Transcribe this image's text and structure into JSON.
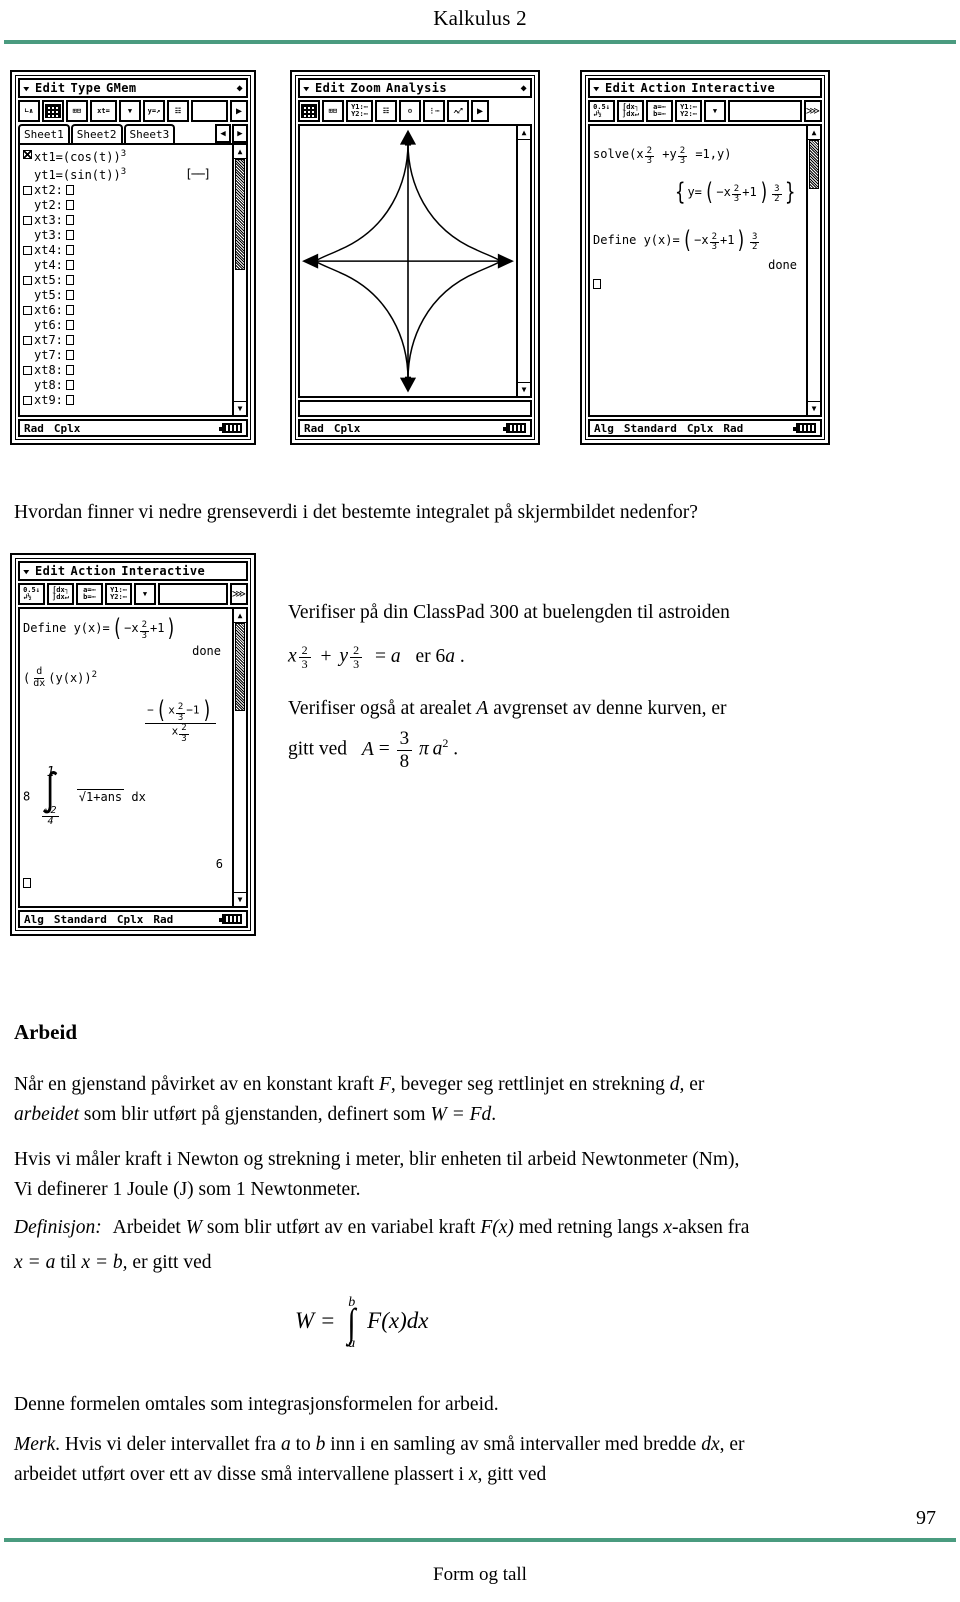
{
  "header": {
    "title": "Kalkulus 2",
    "rule_color": "#4a9b7f"
  },
  "footer": {
    "page_number": "97",
    "text": "Form og tall"
  },
  "calculators": [
    {
      "id": "graph-editor",
      "menubar": [
        "Edit",
        "Type",
        "GMem"
      ],
      "tabs": [
        "Sheet1",
        "Sheet2",
        "Sheet3"
      ],
      "toolbar_icons": [
        "graph-draw-icon",
        "table-icon",
        "table-edit-icon",
        "xt-equals-icon",
        "dropdown-icon",
        "y-equals-icon",
        "zoom-box-icon",
        "right-arrow-icon"
      ],
      "rows": [
        {
          "label": "xt1=(cos(t))",
          "power": "3",
          "checked": true,
          "box": false
        },
        {
          "label": "yt1=(sin(t))",
          "power": "3",
          "checked": null,
          "box": false
        },
        {
          "label": "xt2:",
          "checked": false,
          "box": true
        },
        {
          "label": "yt2:",
          "checked": null,
          "box": true
        },
        {
          "label": "xt3:",
          "checked": false,
          "box": true
        },
        {
          "label": "yt3:",
          "checked": null,
          "box": true
        },
        {
          "label": "xt4:",
          "checked": false,
          "box": true
        },
        {
          "label": "yt4:",
          "checked": null,
          "box": true
        },
        {
          "label": "xt5:",
          "checked": false,
          "box": true
        },
        {
          "label": "yt5:",
          "checked": null,
          "box": true
        },
        {
          "label": "xt6:",
          "checked": false,
          "box": true
        },
        {
          "label": "yt6:",
          "checked": null,
          "box": true
        },
        {
          "label": "xt7:",
          "checked": false,
          "box": true
        },
        {
          "label": "yt7:",
          "checked": null,
          "box": true
        },
        {
          "label": "xt8:",
          "checked": false,
          "box": true
        },
        {
          "label": "yt8:",
          "checked": null,
          "box": true
        },
        {
          "label": "xt9:",
          "checked": false,
          "box": true
        }
      ],
      "statusbar": [
        "Rad",
        "Cplx"
      ]
    },
    {
      "id": "graph-window",
      "menubar": [
        "Edit",
        "Zoom",
        "Analysis"
      ],
      "toolbar_icons": [
        "table-icon",
        "table-edit-icon",
        "y1-y2-icon",
        "zoom-box-icon",
        "zoom-auto-icon",
        "trace-icon",
        "sketch-icon",
        "right-arrow-icon"
      ],
      "curve": "astroid",
      "statusbar": [
        "Rad",
        "Cplx"
      ]
    },
    {
      "id": "main-solve",
      "menubar": [
        "Edit",
        "Action",
        "Interactive"
      ],
      "toolbar_icons": [
        "decimal-fraction-icon",
        "integral-icon",
        "a-b-icon",
        "y1-y2-icon",
        "dropdown-icon",
        "keyboard-icon"
      ],
      "lines": [
        {
          "type": "solve",
          "text": "solve(x",
          "frac1": "2/3",
          "mid": "+y",
          "frac2": "2/3",
          "tail": "=1,y)"
        },
        {
          "type": "result",
          "text": "y=(-x^(2/3)+1)^(3/2)"
        },
        {
          "type": "define",
          "text": "Define y(x)=(-x^(2/3)+1)^(3/2)"
        },
        {
          "type": "done",
          "text": "done"
        }
      ],
      "statusbar": [
        "Alg",
        "Standard",
        "Cplx",
        "Rad"
      ]
    },
    {
      "id": "main-arclength",
      "menubar": [
        "Edit",
        "Action",
        "Interactive"
      ],
      "toolbar_icons": [
        "decimal-fraction-icon",
        "integral-icon",
        "a-b-icon",
        "y1-y2-icon",
        "dropdown-icon",
        "keyboard-icon"
      ],
      "lines": [
        {
          "type": "define",
          "text": "Define y(x)=(-x^(2/3)+1)"
        },
        {
          "type": "done",
          "text": "done"
        },
        {
          "type": "deriv",
          "text": "(d/dx(y(x))^2"
        },
        {
          "type": "result",
          "text": "-(x^(2/3)-1)/x^(2/3)"
        },
        {
          "type": "integral",
          "coefficient": "8",
          "lower": "sqrt(2)/4",
          "upper": "1",
          "body": "1+ans",
          "dx": "dx"
        },
        {
          "type": "answer",
          "text": "6"
        }
      ],
      "statusbar": [
        "Alg",
        "Standard",
        "Cplx",
        "Rad"
      ]
    }
  ],
  "body": {
    "question": "Hvordan finner vi nedre grenseverdi i det bestemte integralet på skjermbildet nedenfor?",
    "task1_line1": "Verifiser på din ClassPad 300 at buelengden til astroiden",
    "task1_formula": {
      "x": "x",
      "exp1_num": "2",
      "exp1_den": "3",
      "plus": "+",
      "y": "y",
      "exp2_num": "2",
      "exp2_den": "3",
      "equals": "= a",
      "tail": "er 6a",
      "period": "."
    },
    "task2_line1": "Verifiser også at arealet",
    "task2_var": "A",
    "task2_line1b": "avgrenset av denne kurven, er",
    "task2_line2_prefix": "gitt ved",
    "task2_formula": {
      "lhs": "A =",
      "num": "3",
      "den": "8",
      "pi": "π",
      "a": "a",
      "sq": "2",
      "period": "."
    },
    "section_heading": "Arbeid",
    "p1_a": "Når en gjenstand påvirket av en konstant kraft",
    "p1_F": "F",
    "p1_b": ", beveger seg rettlinjet en strekning",
    "p1_d": "d,",
    "p1_c": "er",
    "p1_arbeidet": "arbeidet",
    "p1_d2": "som blir utført på gjenstanden, definert som",
    "p1_W": "W = Fd",
    "p1_end": ".",
    "p2_line1": "Hvis vi måler kraft i Newton og strekning i meter, blir enheten til arbeid Newtonmeter (Nm),",
    "p2_line2": "Vi definerer 1 Joule (J) som 1 Newtonmeter.",
    "def_label": "Definisjon:",
    "def_a": "Arbeidet",
    "def_W": "W",
    "def_b": "som blir utført av en variabel kraft",
    "def_F": "F(x)",
    "def_c": "med retning langs",
    "def_x": "x",
    "def_d": "-aksen fra",
    "def_line2_a": "x = a",
    "def_line2_b": "til",
    "def_line2_c": "x = b,",
    "def_line2_d": "er gitt ved",
    "work_formula": {
      "lhs": "W =",
      "upper": "b",
      "lower": "a",
      "integrand": "F(x)dx"
    },
    "p3": "Denne formelen omtales som integrasjonsformelen for arbeid.",
    "p4_label": "Merk",
    "p4_a": ". Hvis vi deler intervallet fra",
    "p4_ab_a": "a",
    "p4_to": "to",
    "p4_ab_b": "b",
    "p4_b": "inn i en samling av små intervaller med bredde",
    "p4_dx": "dx",
    "p4_c": ", er",
    "p4_line2_a": "arbeidet utført over ett av disse små intervallene plassert i",
    "p4_line2_x": "x",
    "p4_line2_b": ", gitt ved"
  }
}
